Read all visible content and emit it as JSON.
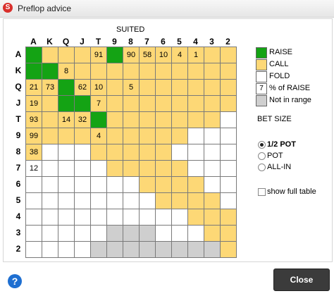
{
  "window": {
    "title": "Preflop advice"
  },
  "suited_label": "SUITED",
  "columns": [
    "A",
    "K",
    "Q",
    "J",
    "T",
    "9",
    "8",
    "7",
    "6",
    "5",
    "4",
    "3",
    "2"
  ],
  "rows": [
    "A",
    "K",
    "Q",
    "J",
    "T",
    "9",
    "8",
    "7",
    "6",
    "5",
    "4",
    "3",
    "2"
  ],
  "grid_cells": [
    [
      "R:",
      "C:",
      "C:",
      "C:",
      "C:91",
      "R:",
      "C:90",
      "C:58",
      "C:10",
      "C:4",
      "C:1",
      "C:",
      "C:"
    ],
    [
      "R:",
      "R:",
      "C:8",
      "C:",
      "C:",
      "C:",
      "C:",
      "C:",
      "C:",
      "C:",
      "C:",
      "C:",
      "C:"
    ],
    [
      "C:21",
      "C:73",
      "R:",
      "C:62",
      "C:10",
      "C:",
      "C:5",
      "C:",
      "C:",
      "C:",
      "C:",
      "C:",
      "C:"
    ],
    [
      "C:19",
      "C:",
      "R:",
      "R:",
      "C:7",
      "C:",
      "C:",
      "C:",
      "C:",
      "C:",
      "C:",
      "C:",
      "C:"
    ],
    [
      "C:93",
      "C:",
      "C:14",
      "C:32",
      "R:",
      "C:",
      "C:",
      "C:",
      "C:",
      "C:",
      "C:",
      "C:",
      "F:"
    ],
    [
      "C:99",
      "C:",
      "C:",
      "C:",
      "C:4",
      "C:",
      "C:",
      "C:",
      "C:",
      "C:",
      "F:",
      "F:",
      "F:"
    ],
    [
      "C:38",
      "F:",
      "F:",
      "F:",
      "C:",
      "C:",
      "C:",
      "C:",
      "C:",
      "F:",
      "F:",
      "F:",
      "F:"
    ],
    [
      "F:12",
      "F:",
      "F:",
      "F:",
      "F:",
      "C:",
      "C:",
      "C:",
      "C:",
      "C:",
      "F:",
      "F:",
      "F:"
    ],
    [
      "F:",
      "F:",
      "F:",
      "F:",
      "F:",
      "F:",
      "F:",
      "C:",
      "C:",
      "C:",
      "C:",
      "F:",
      "F:"
    ],
    [
      "F:",
      "F:",
      "F:",
      "F:",
      "F:",
      "F:",
      "F:",
      "F:",
      "C:",
      "C:",
      "C:",
      "C:",
      "F:"
    ],
    [
      "F:",
      "F:",
      "F:",
      "F:",
      "F:",
      "F:",
      "F:",
      "F:",
      "F:",
      "F:",
      "C:",
      "C:",
      "C:"
    ],
    [
      "F:",
      "F:",
      "F:",
      "F:",
      "F:",
      "N:",
      "N:",
      "N:",
      "F:",
      "F:",
      "F:",
      "C:",
      "C:"
    ],
    [
      "F:",
      "F:",
      "F:",
      "F:",
      "N:",
      "N:",
      "N:",
      "N:",
      "N:",
      "N:",
      "N:",
      "N:",
      "C:"
    ]
  ],
  "legend": {
    "raise": "RAISE",
    "call": "CALL",
    "fold": "FOLD",
    "pct_sample": "7",
    "pct": "% of RAISE",
    "not_in_range": "Not in range"
  },
  "bet_size": {
    "label": "BET SIZE",
    "options": [
      "1/2 POT",
      "POT",
      "ALL-IN"
    ],
    "selected": "1/2 POT"
  },
  "show_full_table": {
    "label": "show full table",
    "checked": false
  },
  "buttons": {
    "close": "Close",
    "help": "?"
  },
  "colors": {
    "raise": "#14a314",
    "call": "#fdd876",
    "fold": "#ffffff",
    "not_in_range": "#cfcfcf"
  },
  "icons": {
    "app": "app-logo-icon",
    "help": "help-icon"
  }
}
